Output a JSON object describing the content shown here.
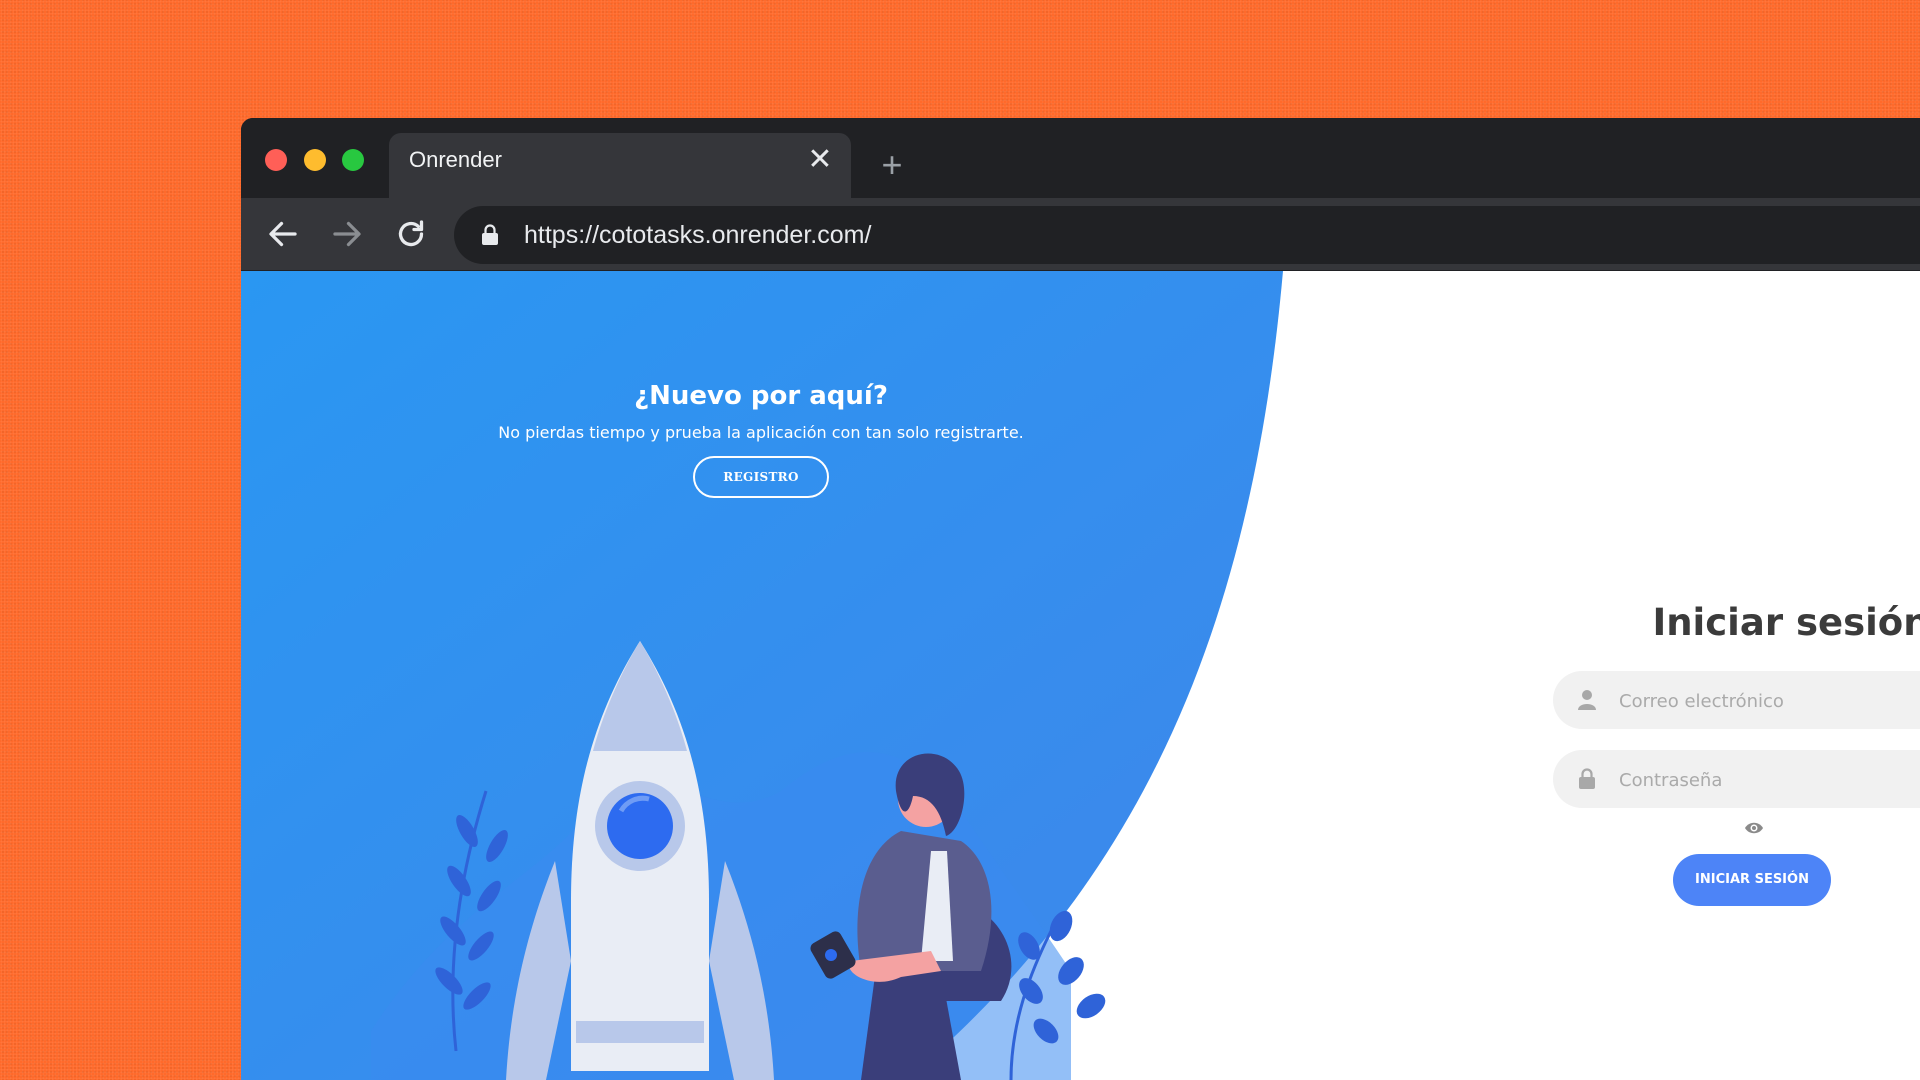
{
  "colors": {
    "background": "#ff6a2b",
    "browser_frame": "#202124",
    "accent_blue": "#2f8ff0",
    "button_blue": "#4d84f7"
  },
  "browser": {
    "tab_title": "Onrender",
    "url": "https://cototasks.onrender.com/",
    "icons": [
      "close-icon",
      "plus-icon",
      "back-arrow-icon",
      "forward-arrow-icon",
      "reload-icon",
      "lock-icon"
    ]
  },
  "hero": {
    "title": "¿Nuevo por aquí?",
    "subtitle": "No pierdas tiempo y prueba la aplicación con tan solo registrarte.",
    "register_label": "REGISTRO"
  },
  "login": {
    "title": "Iniciar sesión",
    "email_placeholder": "Correo electrónico",
    "password_placeholder": "Contraseña",
    "submit_label": "INICIAR SESIÓN",
    "icons": [
      "user-icon",
      "lock-icon",
      "eye-icon"
    ]
  }
}
